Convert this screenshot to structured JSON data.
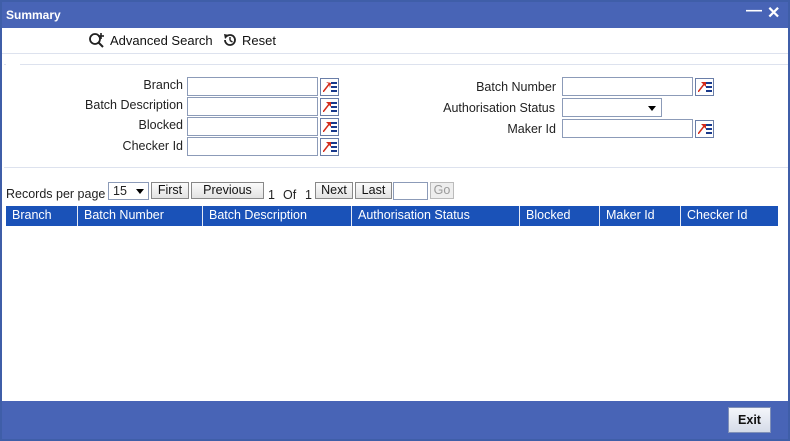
{
  "window": {
    "title": "Summary"
  },
  "toolbar": {
    "advanced_search": "Advanced Search",
    "reset": "Reset"
  },
  "search": {
    "branch_label": "Branch",
    "batch_description_label": "Batch Description",
    "blocked_label": "Blocked",
    "checker_id_label": "Checker Id",
    "batch_number_label": "Batch Number",
    "authorisation_status_label": "Authorisation Status",
    "maker_id_label": "Maker Id"
  },
  "pager": {
    "records_per_page_label": "Records per page",
    "records_per_page_value": "15",
    "first": "First",
    "previous": "Previous",
    "current_page": "1",
    "of_label": "Of",
    "total_pages": "1",
    "next": "Next",
    "last": "Last",
    "go": "Go"
  },
  "grid": {
    "columns": [
      "Branch",
      "Batch Number",
      "Batch Description",
      "Authorisation Status",
      "Blocked",
      "Maker Id",
      "Checker Id"
    ]
  },
  "footer": {
    "exit": "Exit"
  },
  "colors": {
    "titlebar": "#4864b6",
    "grid_header": "#1a52b8"
  }
}
